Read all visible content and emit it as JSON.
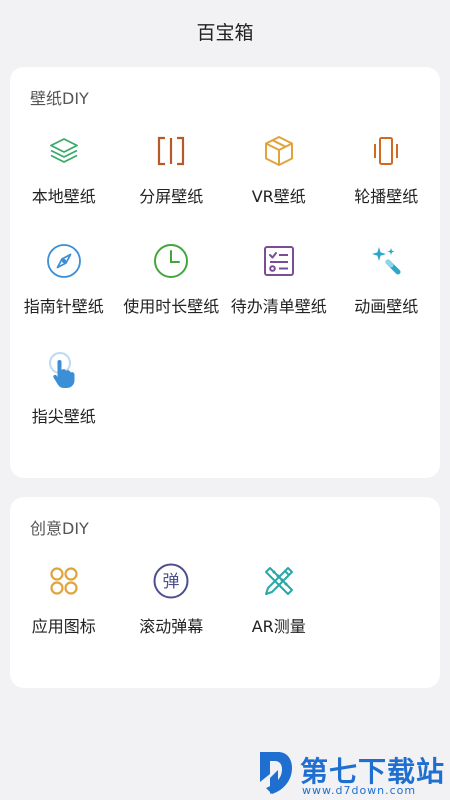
{
  "header": {
    "title": "百宝箱"
  },
  "sections": [
    {
      "title": "壁纸DIY",
      "items": [
        {
          "label": "本地壁纸",
          "icon": "layers-icon",
          "color": "#3aa86b"
        },
        {
          "label": "分屏壁纸",
          "icon": "split-screen-icon",
          "color": "#b85a28"
        },
        {
          "label": "VR壁纸",
          "icon": "cube-icon",
          "color": "#e1a33a"
        },
        {
          "label": "轮播壁纸",
          "icon": "carousel-icon",
          "color": "#d2691e"
        },
        {
          "label": "指南针壁纸",
          "icon": "compass-icon",
          "color": "#3b8fd6"
        },
        {
          "label": "使用时长壁纸",
          "icon": "clock-icon",
          "color": "#43a63c"
        },
        {
          "label": "待办清单壁纸",
          "icon": "checklist-icon",
          "color": "#7a4d9a"
        },
        {
          "label": "动画壁纸",
          "icon": "magic-wand-icon",
          "color": "#2aa7c9"
        },
        {
          "label": "指尖壁纸",
          "icon": "finger-tap-icon",
          "color": "#3b8fd6"
        }
      ]
    },
    {
      "title": "创意DIY",
      "items": [
        {
          "label": "应用图标",
          "icon": "app-grid-icon",
          "color": "#e1a33a"
        },
        {
          "label": "滚动弹幕",
          "icon": "danmaku-icon",
          "color": "#4b4f8c",
          "glyph": "弹"
        },
        {
          "label": "AR测量",
          "icon": "ruler-pencil-icon",
          "color": "#2aa7a7"
        }
      ]
    }
  ],
  "watermark": {
    "name": "第七下载站",
    "url": "www.d7down.com",
    "color": "#1f6fd1"
  }
}
